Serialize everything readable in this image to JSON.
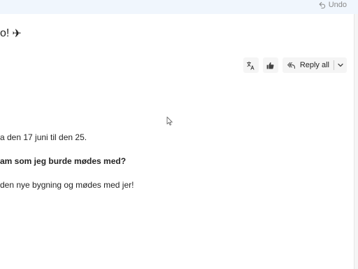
{
  "header": {
    "undo_label": "Undo",
    "undo_icon": "undo-icon"
  },
  "message": {
    "subject_fragment": "o!",
    "subject_emoji": "✈"
  },
  "toolbar": {
    "translate_icon": "translate-icon",
    "like_icon": "thumbs-up-icon",
    "reply_all_label": "Reply all",
    "reply_all_icon": "reply-all-icon",
    "more_icon": "chevron-down-icon"
  },
  "body": {
    "lines": [
      "a den 17 juni til den 25.",
      "am som jeg burde mødes med?",
      "den nye bygning og mødes med jer!"
    ]
  },
  "colors": {
    "topbar_bg": "#f0f6fd",
    "text": "#242424",
    "muted": "#8a8a8a",
    "button_bg": "#f5f5f5"
  }
}
